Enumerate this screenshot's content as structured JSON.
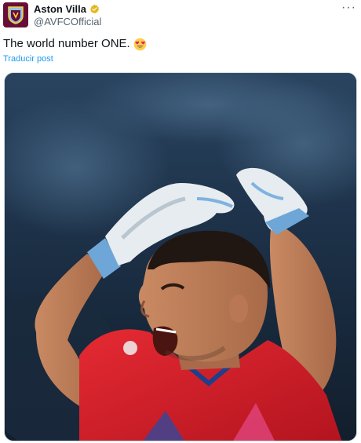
{
  "tweet": {
    "author": {
      "display_name": "Aston Villa",
      "handle": "@AVFCOfficial",
      "verified": true,
      "avatar_icon": "aston-villa-crest-icon"
    },
    "text": "The world number ONE.",
    "emoji": "heart-eyes-emoji",
    "translate_label": "Traducir post",
    "more_icon": "more-options-icon"
  },
  "colors": {
    "brand_claret": "#670e36",
    "link_blue": "#1d9bf0",
    "verified_gold": "#e2b719",
    "secondary_text": "#536471",
    "kit_red": "#d8202e"
  }
}
